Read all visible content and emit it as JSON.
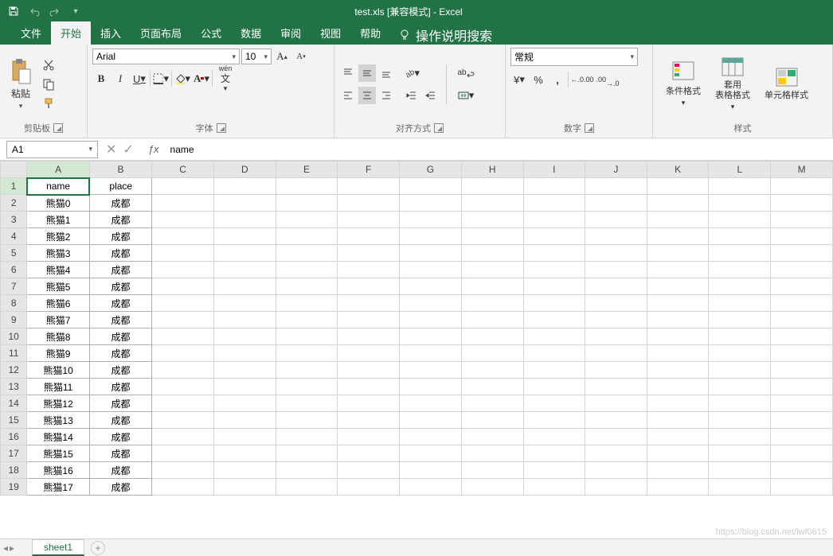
{
  "title": "test.xls  [兼容模式]  -  Excel",
  "qat": {
    "save": "保存",
    "undo": "撤销",
    "redo": "重做"
  },
  "tabs": {
    "file": "文件",
    "home": "开始",
    "insert": "插入",
    "layout": "页面布局",
    "formulas": "公式",
    "data": "数据",
    "review": "审阅",
    "view": "视图",
    "help": "帮助",
    "tell_me": "操作说明搜索"
  },
  "ribbon": {
    "clipboard": {
      "label": "剪贴板",
      "paste": "粘贴"
    },
    "font": {
      "label": "字体",
      "name": "Arial",
      "size": "10",
      "bold": "B",
      "italic": "I",
      "underline": "U",
      "wen": "wén",
      "wen2": "文"
    },
    "alignment": {
      "label": "对齐方式",
      "wrap": "ab"
    },
    "number": {
      "label": "数字",
      "format": "常规",
      "currency_cn": "¥",
      "percent": "%",
      "comma": ",",
      "inc": ".00",
      "dec": ".00"
    },
    "styles": {
      "label": "样式",
      "cond": "条件格式",
      "table": "套用\n表格格式",
      "cell": "单元格样式"
    }
  },
  "namebox": "A1",
  "formula": "name",
  "columns": [
    "A",
    "B",
    "C",
    "D",
    "E",
    "F",
    "G",
    "H",
    "I",
    "J",
    "K",
    "L",
    "M"
  ],
  "data_rows": [
    [
      "name",
      "place"
    ],
    [
      "熊猫0",
      "成都"
    ],
    [
      "熊猫1",
      "成都"
    ],
    [
      "熊猫2",
      "成都"
    ],
    [
      "熊猫3",
      "成都"
    ],
    [
      "熊猫4",
      "成都"
    ],
    [
      "熊猫5",
      "成都"
    ],
    [
      "熊猫6",
      "成都"
    ],
    [
      "熊猫7",
      "成都"
    ],
    [
      "熊猫8",
      "成都"
    ],
    [
      "熊猫9",
      "成都"
    ],
    [
      "熊猫10",
      "成都"
    ],
    [
      "熊猫11",
      "成都"
    ],
    [
      "熊猫12",
      "成都"
    ],
    [
      "熊猫13",
      "成都"
    ],
    [
      "熊猫14",
      "成都"
    ],
    [
      "熊猫15",
      "成都"
    ],
    [
      "熊猫16",
      "成都"
    ],
    [
      "熊猫17",
      "成都"
    ]
  ],
  "row_count": 19,
  "sheet": {
    "name": "sheet1"
  },
  "watermark": "https://blog.csdn.net/lwf0615"
}
